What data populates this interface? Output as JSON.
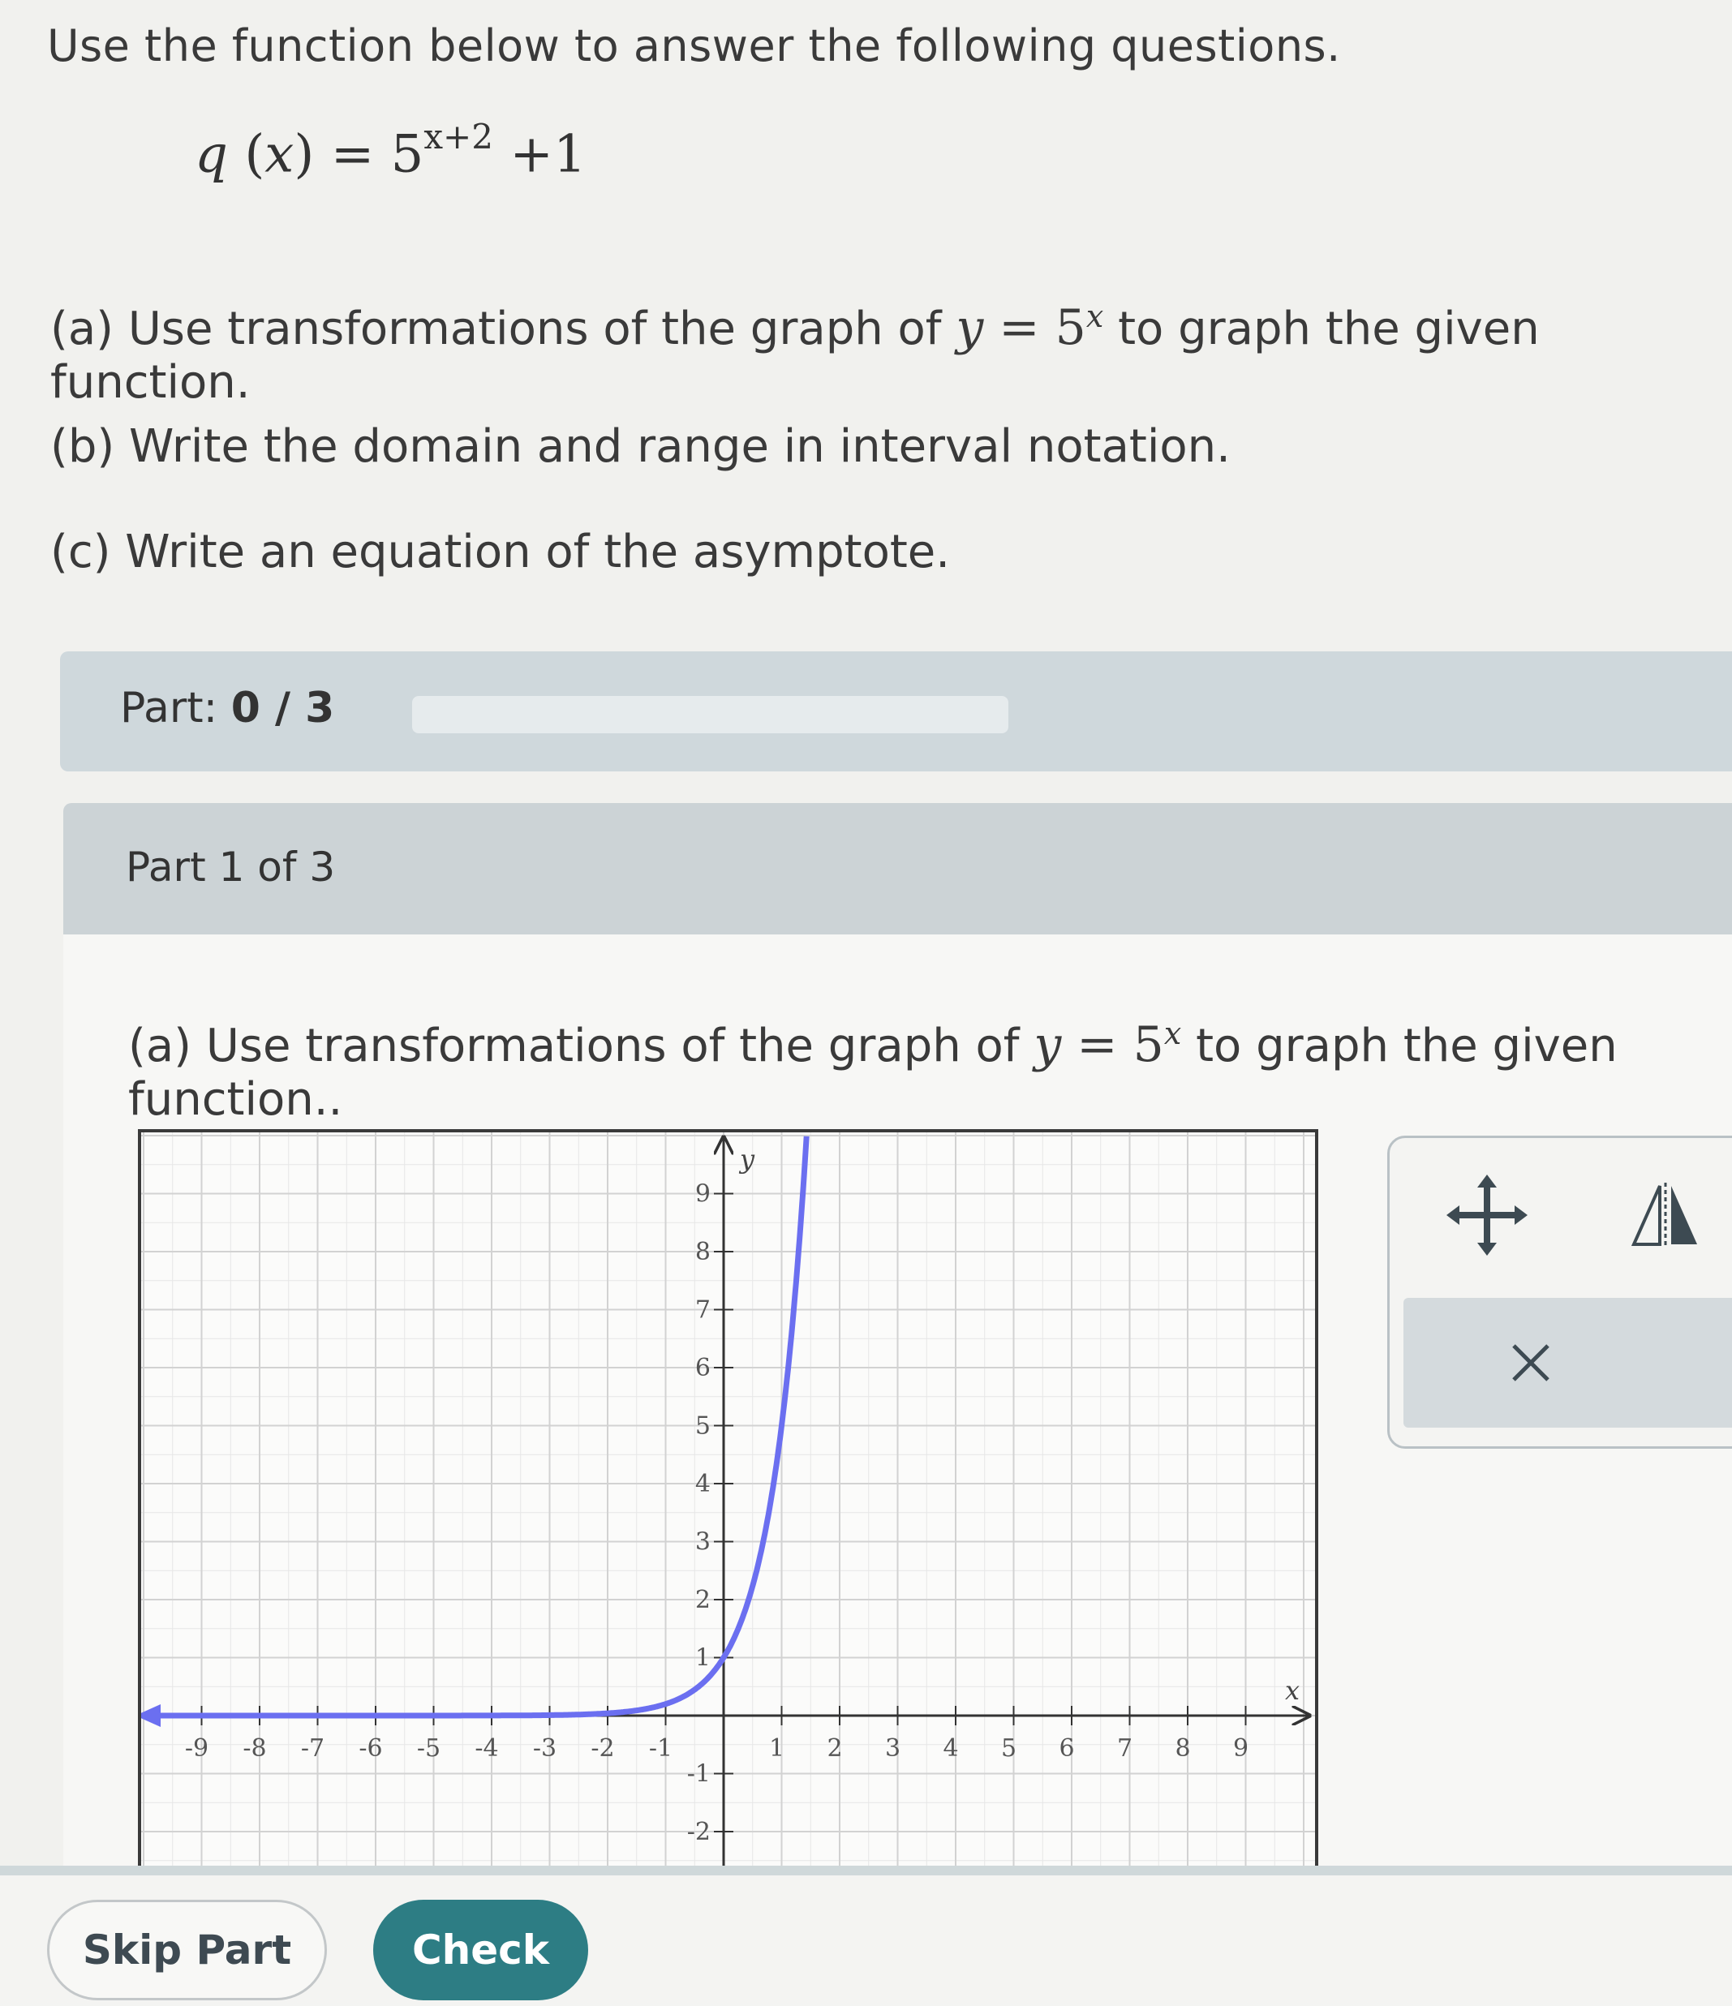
{
  "intro": "Use the function below to answer the following questions.",
  "formula": {
    "lhs": "q",
    "arg": "x",
    "base": "5",
    "exponent": "x+2",
    "tail": "+1"
  },
  "questions": {
    "a_prefix": "(a) Use transformations of the graph of",
    "a_suffix": "to graph the given function.",
    "b": "(b) Write the domain and range in interval notation.",
    "c": "(c) Write an equation of the asymptote."
  },
  "progress": {
    "label": "Part:",
    "value": "0 / 3",
    "fraction": 0.0
  },
  "part_header": "Part 1 of 3",
  "part_question": {
    "prefix": "(a) Use transformations of the graph of",
    "suffix": "to graph the given function.."
  },
  "base_function": {
    "y": "y",
    "base": "5",
    "exp": "x"
  },
  "graph": {
    "x_axis_label": "x",
    "y_axis_label": "y",
    "x_ticks": [
      -9,
      -8,
      -7,
      -6,
      -5,
      -4,
      -3,
      -2,
      -1,
      1,
      2,
      3,
      4,
      5,
      6,
      7,
      8,
      9
    ],
    "y_ticks": [
      9,
      8,
      7,
      6,
      5,
      4,
      3,
      2,
      1,
      -1,
      -2
    ],
    "xlim": [
      -10,
      10
    ],
    "ylim": [
      -2.6,
      10
    ],
    "curve_color": "#6b6ff0",
    "curve": "y = 5^x"
  },
  "tools": {
    "move_icon": "move-arrows-icon",
    "reflect_icon": "reflect-icon",
    "delete_icon": "close-icon"
  },
  "buttons": {
    "skip": "Skip Part",
    "check": "Check"
  }
}
